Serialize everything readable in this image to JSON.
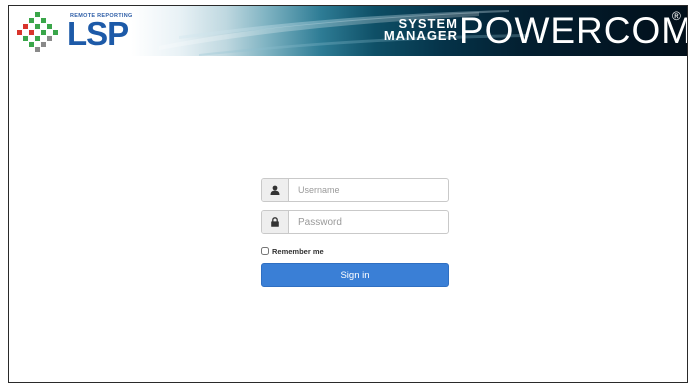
{
  "header": {
    "logo_tagline": "REMOTE REPORTING",
    "logo_text": "LSP",
    "system_label": "SYSTEM",
    "manager_label": "MANAGER",
    "product_name": "POWERCOM",
    "registered_mark": "®"
  },
  "login": {
    "username": {
      "value": "",
      "placeholder": "Username",
      "icon": "user-icon"
    },
    "password": {
      "value": "",
      "placeholder": "Password",
      "icon": "lock-icon"
    },
    "remember_label": "Remember me",
    "remember_checked": false,
    "signin_label": "Sign in"
  },
  "colors": {
    "primary_button": "#3a7fd6",
    "brand_blue": "#1d5aa8",
    "logo_green": "#3aa64a",
    "logo_red": "#d9342b"
  }
}
